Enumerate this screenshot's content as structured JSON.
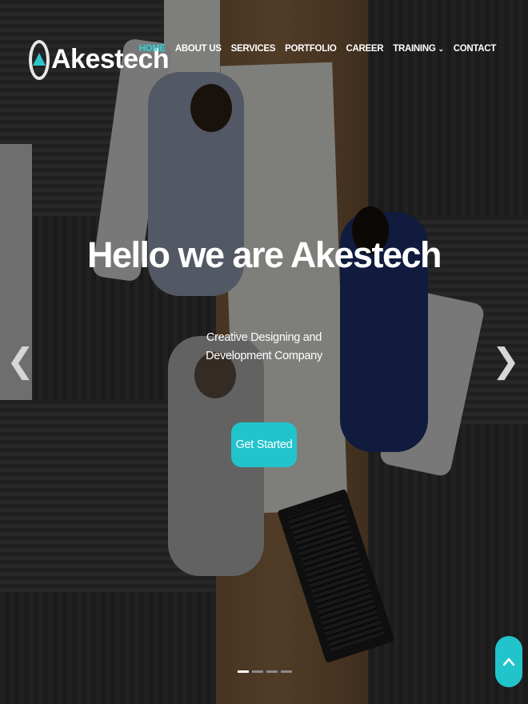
{
  "brand": {
    "name": "Akestech"
  },
  "nav": {
    "items": [
      {
        "label": "HOME",
        "active": true
      },
      {
        "label": "ABOUT US"
      },
      {
        "label": "SERVICES"
      },
      {
        "label": "PORTFOLIO"
      },
      {
        "label": "CAREER"
      },
      {
        "label": "TRAINING",
        "dropdown": true
      },
      {
        "label": "CONTACT"
      }
    ]
  },
  "hero": {
    "title": "Hello we are Akestech",
    "subtitle": "Creative Designing and Development Company",
    "cta_label": "Get Started",
    "prev_glyph": "❮",
    "next_glyph": "❯",
    "slide_count": 4,
    "active_slide": 1
  },
  "colors": {
    "accent": "#22c4cc",
    "nav_active": "#2ed3d8",
    "text": "#ffffff"
  },
  "icons": {
    "logo": "akestech-logo-icon",
    "prev": "chevron-left-icon",
    "next": "chevron-right-icon",
    "scroll_top": "chevron-up-icon",
    "dropdown": "chevron-down-icon"
  }
}
